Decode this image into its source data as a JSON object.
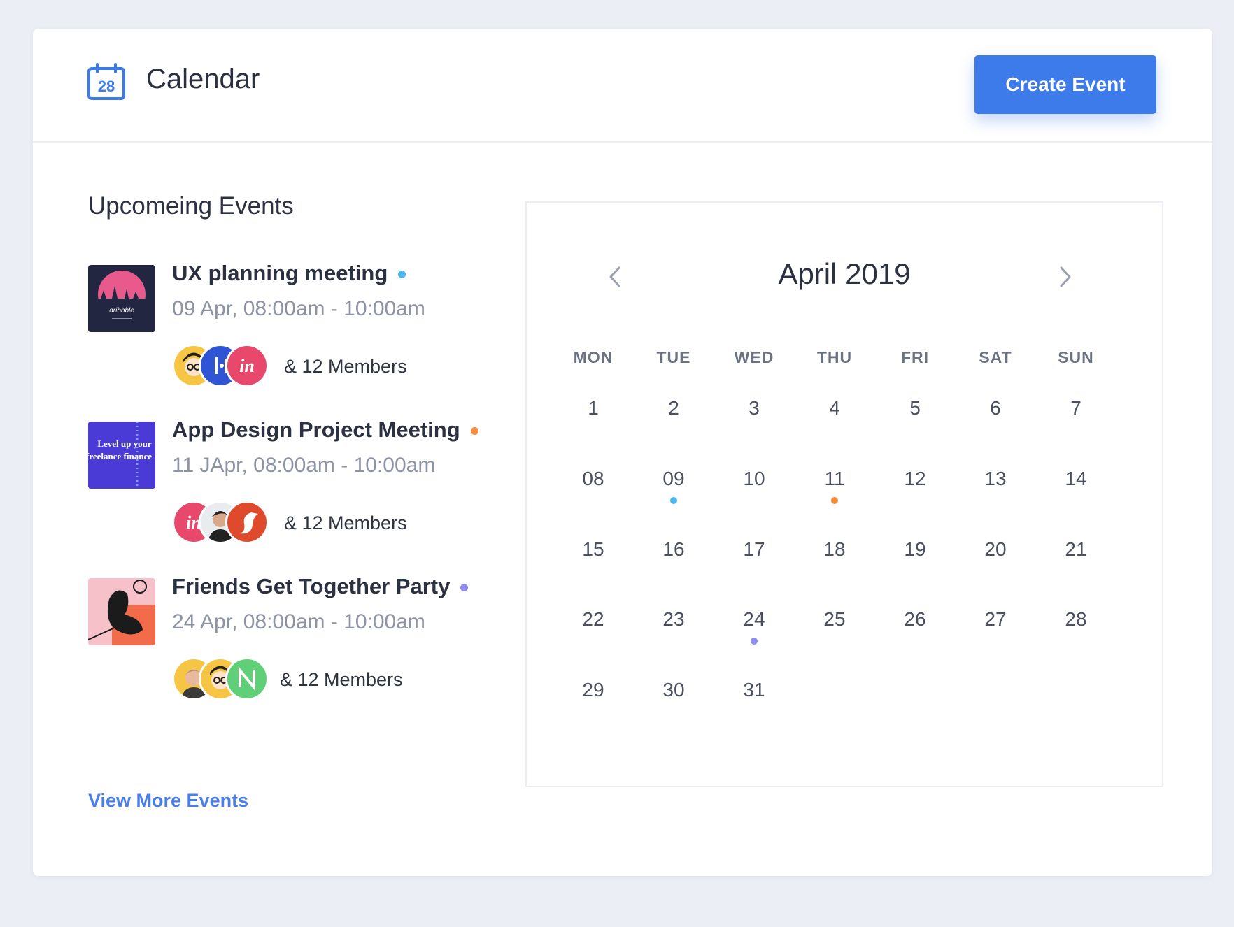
{
  "header": {
    "title": "Calendar",
    "icon_day": "28",
    "create_button": "Create Event"
  },
  "events": {
    "section_title": "Upcomeing Events",
    "items": [
      {
        "name": "UX planning meeting",
        "time": "09 Apr, 08:00am - 10:00am",
        "members": "& 12 Members",
        "dot_color": "#4cb8ee",
        "thumb_text": "dribbble"
      },
      {
        "name": "App Design Project Meeting",
        "time": "11 JApr, 08:00am - 10:00am",
        "members": "& 12 Members",
        "dot_color": "#f58b3c",
        "thumb_text": "Level up your freelance finance"
      },
      {
        "name": "Friends Get Together Party",
        "time": "24 Apr, 08:00am - 10:00am",
        "members": "& 12 Members",
        "dot_color": "#8e8cf0"
      }
    ],
    "view_more": "View More Events"
  },
  "calendar": {
    "month": "April 2019",
    "weekdays": [
      "MON",
      "TUE",
      "WED",
      "THU",
      "FRI",
      "SAT",
      "SUN"
    ],
    "weeks": [
      [
        "1",
        "2",
        "3",
        "4",
        "5",
        "6",
        "7"
      ],
      [
        "08",
        "09",
        "10",
        "11",
        "12",
        "13",
        "14"
      ],
      [
        "15",
        "16",
        "17",
        "18",
        "19",
        "20",
        "21"
      ],
      [
        "22",
        "23",
        "24",
        "25",
        "26",
        "27",
        "28"
      ],
      [
        "29",
        "30",
        "31",
        "",
        "",
        "",
        ""
      ]
    ],
    "marked_days": [
      {
        "day": "09",
        "color": "#4cb8ee"
      },
      {
        "day": "11",
        "color": "#f58b3c"
      },
      {
        "day": "24",
        "color": "#8e8cf0"
      }
    ]
  },
  "colors": {
    "accent": "#3d7bea",
    "link": "#4a7ee8",
    "background": "#eceef6"
  }
}
